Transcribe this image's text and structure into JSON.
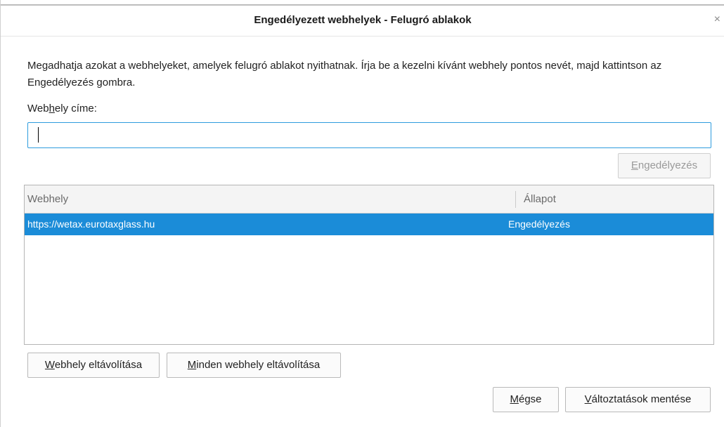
{
  "window": {
    "title": "Engedélyezett webhelyek - Felugró ablakok",
    "close_glyph": "×"
  },
  "description": "Megadhatja azokat a webhelyeket, amelyek felugró ablakot nyithatnak. Írja be a kezelni kívánt webhely pontos nevét, majd kattintson az Engedélyezés gombra.",
  "address_field": {
    "label_pre": "Web",
    "label_accel": "h",
    "label_post": "ely címe:",
    "value": ""
  },
  "allow_button": {
    "accel": "E",
    "rest": "ngedélyezés",
    "disabled": true
  },
  "table": {
    "columns": [
      "Webhely",
      "Állapot"
    ],
    "rows": [
      {
        "site": "https://wetax.eurotaxglass.hu",
        "status": "Engedélyezés",
        "selected": true
      }
    ]
  },
  "buttons": {
    "remove": {
      "accel": "W",
      "rest": "ebhely eltávolítása"
    },
    "remove_all": {
      "accel": "M",
      "rest": "inden webhely eltávolítása"
    },
    "cancel": {
      "accel": "M",
      "rest": "égse"
    },
    "save": {
      "accel": "V",
      "rest": "áltoztatások mentése"
    }
  },
  "colors": {
    "selection": "#1b8cd8",
    "input_focus": "#2e9cde"
  }
}
